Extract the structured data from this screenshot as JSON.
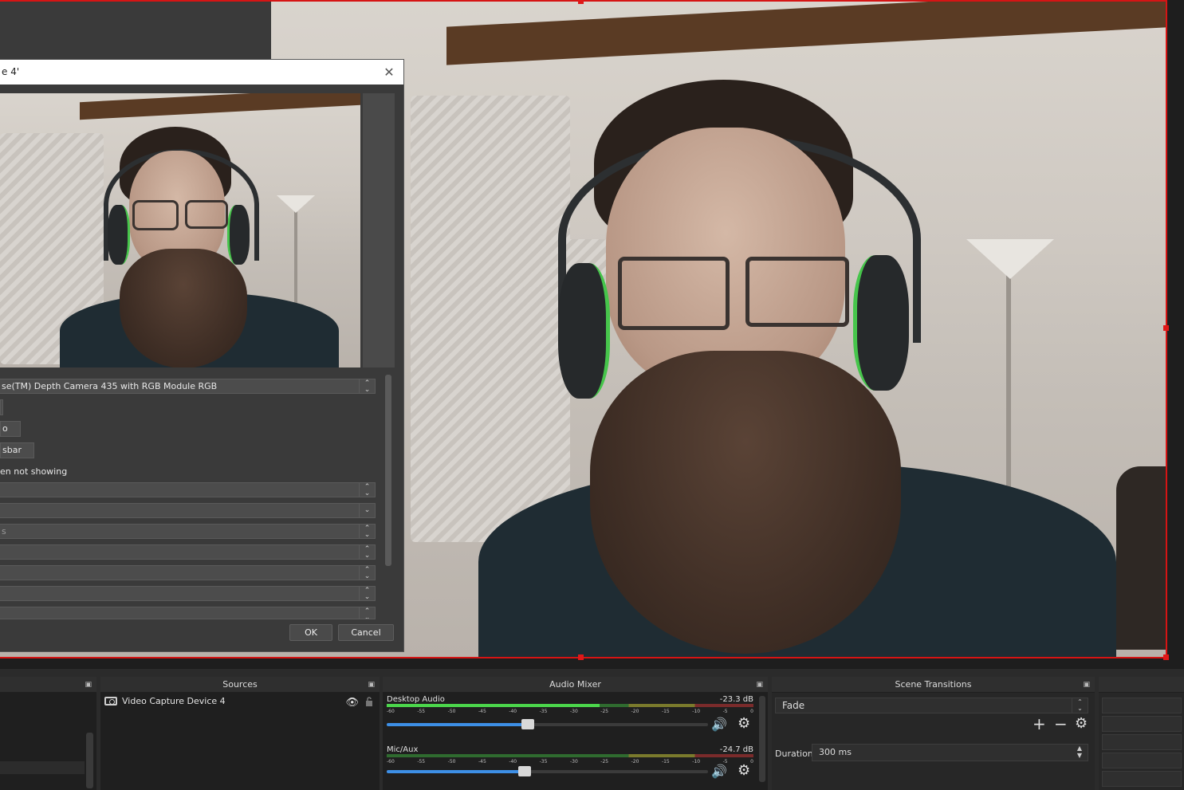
{
  "dialog": {
    "title": "e 4'",
    "device_value": "se(TM) Depth Camera 435 with RGB Module RGB",
    "btn_configure": "o",
    "btn_crossbar": "sbar",
    "checkbox_label": "en not showing",
    "row_resolution_hint": "s",
    "ok_label": "OK",
    "cancel_label": "Cancel"
  },
  "docks": {
    "sources": {
      "title": "Sources",
      "items": [
        {
          "label": "Video Capture Device 4"
        }
      ]
    },
    "mixer": {
      "title": "Audio Mixer",
      "channels": [
        {
          "label": "Desktop Audio",
          "db": "-23.3 dB",
          "level": 0.58,
          "volume": 0.44
        },
        {
          "label": "Mic/Aux",
          "db": "-24.7 dB",
          "level": 0.0,
          "volume": 0.43
        }
      ],
      "ticks": [
        "-60",
        "-55",
        "-50",
        "-45",
        "-40",
        "-35",
        "-30",
        "-25",
        "-20",
        "-15",
        "-10",
        "-5",
        "0"
      ]
    },
    "transitions": {
      "title": "Scene Transitions",
      "selected": "Fade",
      "duration_label": "Duration",
      "duration_value": "300 ms"
    }
  },
  "icons": {
    "close": "close-icon",
    "eye": "eye-icon",
    "lock": "lock-icon",
    "speaker": "speaker-icon",
    "gear": "gear-icon",
    "plus": "plus-icon",
    "minus": "minus-icon"
  },
  "colors": {
    "selection_border": "#d61414",
    "meter_green": "#4bd64b",
    "volume_blue": "#3d8fe6"
  }
}
